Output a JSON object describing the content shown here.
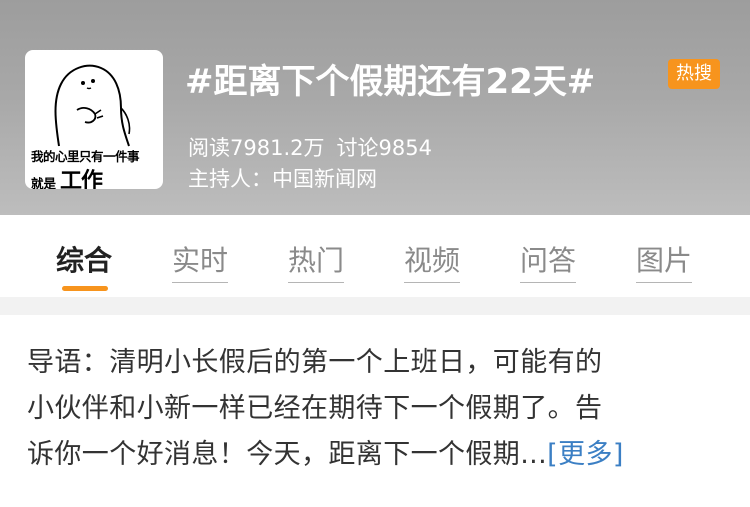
{
  "topic": {
    "title": "#距离下个假期还有22天#",
    "badge": "热搜",
    "reads": "阅读7981.2万",
    "discussions": "讨论9854",
    "host": "主持人：中国新闻网"
  },
  "thumbnail": {
    "line1": "我的心里只有一件事",
    "line2_prefix": "就是",
    "line2_big": "工作"
  },
  "tabs": [
    {
      "label": "综合",
      "active": true
    },
    {
      "label": "实时",
      "active": false
    },
    {
      "label": "热门",
      "active": false
    },
    {
      "label": "视频",
      "active": false
    },
    {
      "label": "问答",
      "active": false
    },
    {
      "label": "图片",
      "active": false
    }
  ],
  "intro": {
    "line1": "导语：清明小长假后的第一个上班日，可能有的",
    "line2": "小伙伴和小新一样已经在期待下一个假期了。告",
    "line3": "诉你一个好消息！今天，距离下一个假期...",
    "more": "[更多]"
  },
  "colors": {
    "accent": "#f7941d",
    "link": "#3b7fc4",
    "header_bg": "#a8a8a8"
  }
}
